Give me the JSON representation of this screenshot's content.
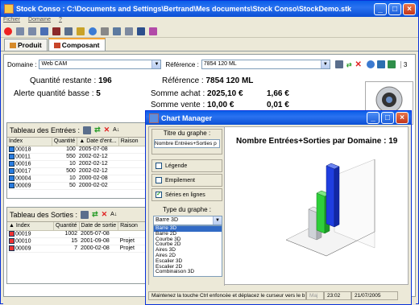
{
  "window": {
    "title": "Stock Conso : C:\\Documents and Settings\\Bertrand\\Mes documents\\Stock Conso\\StockDemo.stk"
  },
  "menu": {
    "items": [
      "Fichier",
      "Domaine",
      "?"
    ]
  },
  "tabs": [
    {
      "label": "Produit"
    },
    {
      "label": "Composant"
    }
  ],
  "form": {
    "domaine_label": "Domaine :",
    "domaine_value": "Web CAM",
    "reference_label": "Référence :",
    "reference_value": "7854 120 ML",
    "counter": "3"
  },
  "info": {
    "quantite_restante_label": "Quantité restante :",
    "quantite_restante": "196",
    "alerte_label": "Alerte quantité basse :",
    "alerte": "5",
    "reference_label": "Référence :",
    "reference": "7854 120 ML",
    "somme_achat_label": "Somme achat :",
    "somme_achat": "2025,10 €",
    "somme_achat_2": "1,66 €",
    "somme_vente_label": "Somme vente :",
    "somme_vente": "10,00 €",
    "somme_vente_2": "0,01 €"
  },
  "entrees": {
    "title": "Tableau des Entrées :",
    "columns": [
      "Index",
      "Quantité",
      "Date d'ent...",
      "Raison"
    ],
    "rows": [
      [
        "00018",
        "100",
        "2005-07-08",
        ""
      ],
      [
        "00011",
        "550",
        "2002-02-12",
        ""
      ],
      [
        "00016",
        "10",
        "2002-02-12",
        ""
      ],
      [
        "00017",
        "500",
        "2002-02-12",
        ""
      ],
      [
        "00004",
        "10",
        "2000-02-08",
        ""
      ],
      [
        "00009",
        "50",
        "2000-02-02",
        ""
      ]
    ]
  },
  "sorties": {
    "title": "Tableau des Sorties :",
    "columns": [
      "Index",
      "Quantité",
      "Date de sortie",
      "Raison"
    ],
    "rows": [
      [
        "00019",
        "1002",
        "2005-07-08",
        ""
      ],
      [
        "00010",
        "15",
        "2001-09-08",
        "Projet"
      ],
      [
        "00009",
        "7",
        "2000-02-08",
        "Projet"
      ]
    ]
  },
  "dialog": {
    "title": "Chart Manager",
    "group_title": "Titre du graphe :",
    "title_input": "Nombre Entrées+Sorties p",
    "chk_legende": "Légende",
    "chk_empilement": "Empilement",
    "chk_series": "Séries en lignes",
    "type_label": "Type du graphe :",
    "type_value": "Barre 3D",
    "types": [
      "Barre 3D",
      "Barre 2D",
      "Courbe 3D",
      "Courbe 2D",
      "Aires 3D",
      "Aires 2D",
      "Escalier 3D",
      "Escalier 2D",
      "Combinaison 3D"
    ],
    "chart_title": "Nombre Entrées+Sorties par Domaine : 19",
    "status_hint": "Maintenez la touche Ctrl enfoncée et déplacez le curseur vers le b",
    "status_maj": "Maj",
    "status_time": "23:02",
    "status_date": "21/07/2005"
  },
  "colors": {
    "accent": "#0a5ee8",
    "tab_highlight": "#f3a537",
    "bar_blue": "#1f3ee0",
    "bar_green": "#2ecf3a",
    "bar_gray": "#cfd3d8"
  }
}
